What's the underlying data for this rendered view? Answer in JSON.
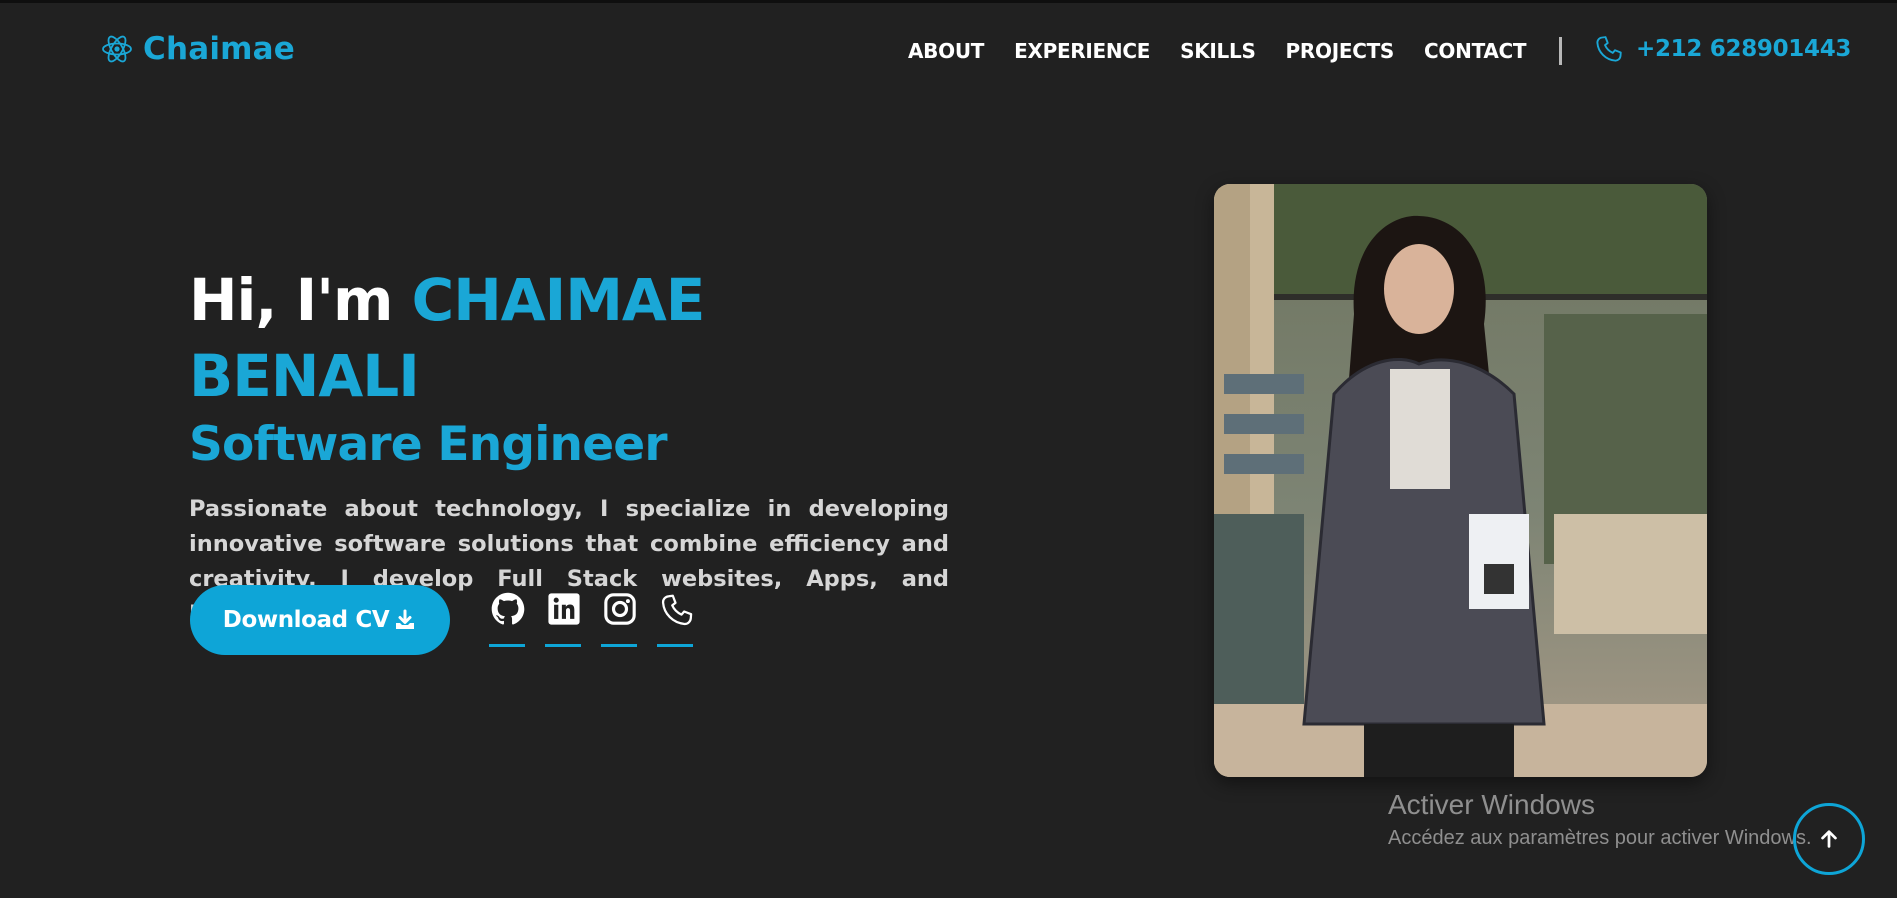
{
  "nav": {
    "brand": "Chaimae",
    "links": [
      "ABOUT",
      "EXPERIENCE",
      "SKILLS",
      "PROJECTS",
      "CONTACT"
    ],
    "phone": "+212 628901443"
  },
  "hero": {
    "greeting_prefix": "Hi, I'm",
    "name": "CHAIMAE BENALI",
    "role": "Software Engineer",
    "intro": "Passionate about technology, I specialize in developing innovative software solutions that combine efficiency and creativity. I develop Full Stack websites, Apps, and Platforms.",
    "cv_button": "Download CV"
  },
  "social_icons": [
    "github-icon",
    "linkedin-icon",
    "instagram-icon",
    "phone-icon"
  ],
  "watermark": {
    "title": "Activer Windows",
    "subtitle": "Accédez aux paramètres pour activer Windows."
  },
  "colors": {
    "background": "#212121",
    "accent": "#1aa7d6",
    "button": "#0ea5d7",
    "text": "#ffffff"
  }
}
